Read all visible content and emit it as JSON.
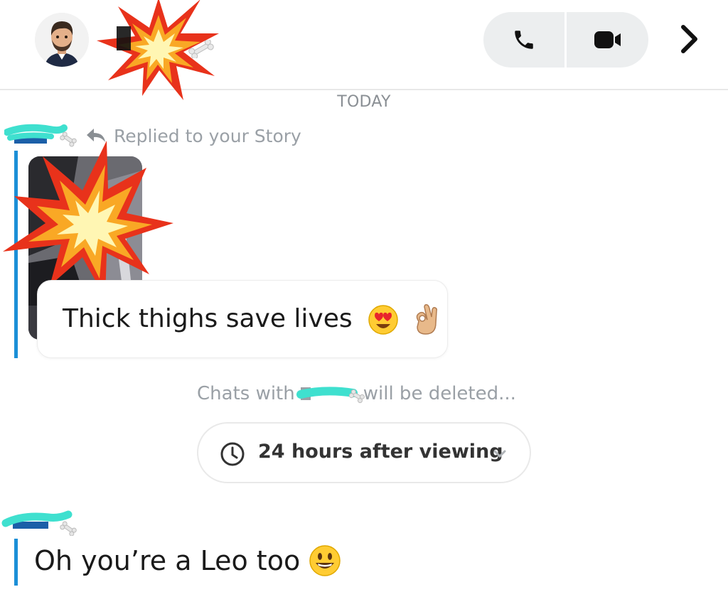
{
  "header": {
    "avatar_icon": "bitmoji-avatar-icon",
    "call_icon": "phone-icon",
    "video_icon": "video-camera-icon",
    "more_icon": "chevron-right-icon"
  },
  "conversation": {
    "date_divider": "TODAY",
    "reply_label": "Replied to your Story",
    "reply_message": "Thick thighs save lives",
    "reply_emojis": [
      "heart-eyes-emoji",
      "ok-hand-emoji"
    ],
    "chats_deleted_prefix": "Chats with",
    "chats_deleted_suffix": "will be deleted...",
    "timer_option": "24 hours after viewing",
    "second_message": "Oh you’re a Leo too",
    "second_message_emoji": "smiley-emoji"
  },
  "colors": {
    "accent_bar": "#1b8fd7",
    "redaction": "#3fe0cf",
    "muted_text": "#9aa0a6"
  }
}
